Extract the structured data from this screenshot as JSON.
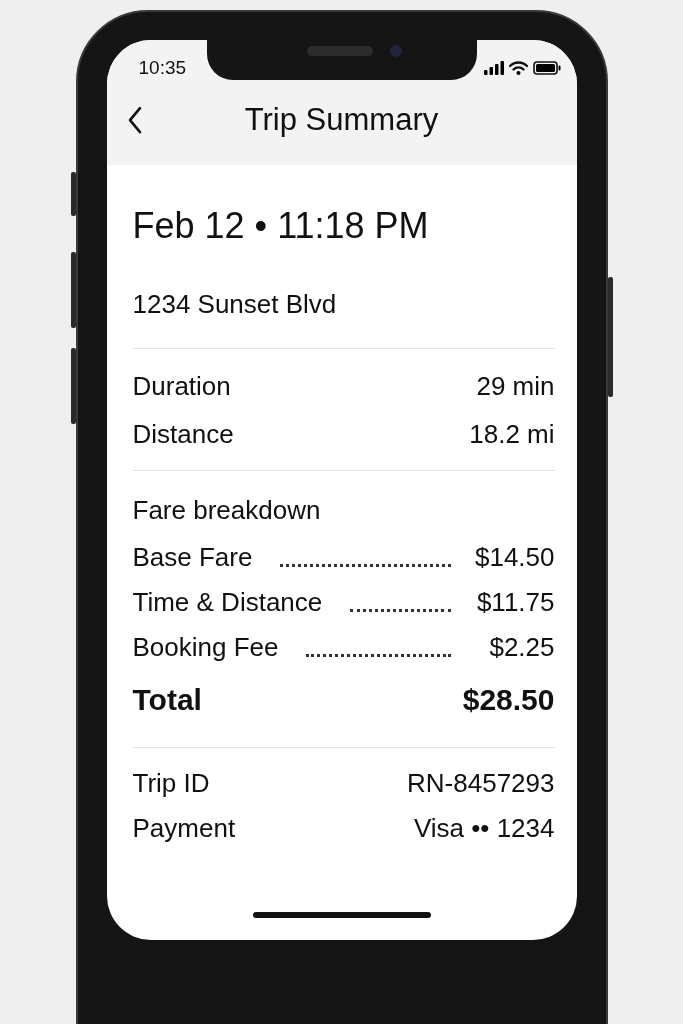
{
  "status_bar": {
    "time": "10:35"
  },
  "header": {
    "title": "Trip Summary"
  },
  "trip": {
    "datetime": "Feb 12 • 11:18 PM",
    "address": "1234 Sunset Blvd"
  },
  "stats": [
    {
      "label": "Duration",
      "value": "29 min"
    },
    {
      "label": "Distance",
      "value": "18.2 mi"
    }
  ],
  "fare": {
    "title": "Fare breakdown",
    "items": [
      {
        "label": "Base Fare",
        "amount": "$14.50"
      },
      {
        "label": "Time & Distance",
        "amount": "$11.75"
      },
      {
        "label": "Booking Fee",
        "amount": "$2.25"
      }
    ],
    "total": {
      "label": "Total",
      "amount": "$28.50"
    }
  },
  "details": [
    {
      "label": "Trip ID",
      "value": "RN-8457293"
    },
    {
      "label": "Payment",
      "value": "Visa •• 1234"
    }
  ]
}
